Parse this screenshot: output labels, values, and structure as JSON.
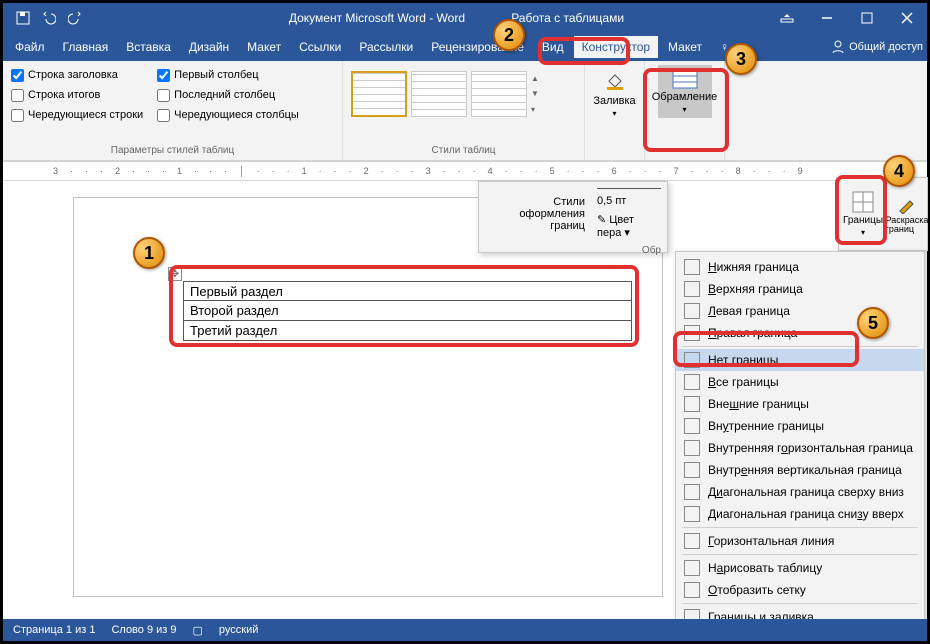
{
  "title": "Документ Microsoft Word - Word",
  "title_context": "Работа с таблицами",
  "tabs": {
    "file": "Файл",
    "home": "Главная",
    "insert": "Вставка",
    "design": "Дизайн",
    "layout": "Макет",
    "refs": "Ссылки",
    "mail": "Рассылки",
    "review": "Рецензирование",
    "view": "Вид",
    "ctx_design": "Конструктор",
    "ctx_layout": "Макет",
    "tell_me": "Q",
    "share": "Общий доступ"
  },
  "ribbon": {
    "checks": {
      "header_row": "Строка заголовка",
      "total_row": "Строка итогов",
      "banded_rows": "Чередующиеся строки",
      "first_col": "Первый столбец",
      "last_col": "Последний столбец",
      "banded_cols": "Чередующиеся столбцы"
    },
    "group_style_options": "Параметры стилей таблиц",
    "group_table_styles": "Стили таблиц",
    "shading": "Заливка",
    "borders_btn": "Обрамление"
  },
  "popout1": {
    "label": "Стили оформления границ",
    "weight": "0,5 пт",
    "pen": "Цвет пера",
    "sub": "Обр"
  },
  "popout_right": {
    "borders": "Границы",
    "painter": "Раскраска границ"
  },
  "border_menu": {
    "items": [
      {
        "label": "Нижняя граница",
        "acc": "Н"
      },
      {
        "label": "Верхняя граница",
        "acc": "В"
      },
      {
        "label": "Левая граница",
        "acc": "Л"
      },
      {
        "label": "Правая граница",
        "acc": "П"
      },
      {
        "label": "Нет границы",
        "acc": "Н",
        "highlight": true
      },
      {
        "label": "Все границы",
        "acc": "В"
      },
      {
        "label": "Внешние границы",
        "acc": "ш"
      },
      {
        "label": "Внутренние границы",
        "acc": "у"
      },
      {
        "label": "Внутренняя горизонтальная граница",
        "acc": "о"
      },
      {
        "label": "Внутренняя вертикальная граница",
        "acc": "е"
      },
      {
        "label": "Диагональная граница сверху вниз",
        "acc": "и"
      },
      {
        "label": "Диагональная граница снизу вверх",
        "acc": "з"
      },
      {
        "label": "Горизонтальная линия",
        "acc": "Г"
      },
      {
        "label": "Нарисовать таблицу",
        "acc": "а"
      },
      {
        "label": "Отобразить сетку",
        "acc": "О"
      },
      {
        "label": "Границы и заливка...",
        "acc": "и"
      }
    ]
  },
  "table_rows": [
    "Первый раздел",
    "Второй раздел",
    "Третий раздел"
  ],
  "status": {
    "page": "Страница 1 из 1",
    "words": "Слово 9 из 9",
    "lang": "русский"
  },
  "ruler": "3···2···1···│···1···2···3···4···5···6···7···8···9"
}
